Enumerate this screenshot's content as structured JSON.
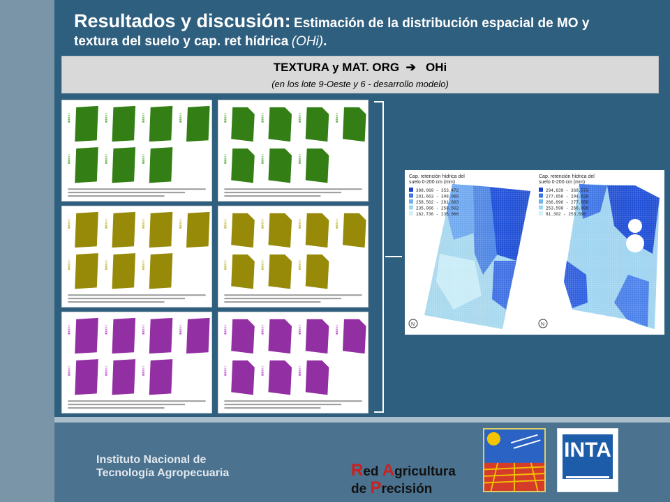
{
  "title": {
    "main": "Resultados y discusión:",
    "sub_line1": "Estimación de la distribución espacial de MO y",
    "sub_line2": "textura del suelo y cap. ret hídrica",
    "sub_italic": "(OHi)",
    "sub_end": "."
  },
  "banner": {
    "heading_left": "TEXTURA y MAT. ORG",
    "arrow": "➔",
    "heading_right": "OHi",
    "subtitle": "(en los lote 9-Oeste  y 6 - desarrollo modelo)"
  },
  "panels": {
    "green_color": "#3f9b1c",
    "yellow_color": "#b7a90a",
    "purple_color": "#b23ac6"
  },
  "result_map": {
    "left_legend_title": "Cap. retención hídrica del suelo 0-200 cm (mm)",
    "left_legend": [
      "308.069 - 353.472",
      "281.663 - 308.069",
      "258.502 - 281.663",
      "235.066 - 258.502",
      "162.736 - 235.066"
    ],
    "right_legend_title": "Cap. retención hídrica del suelo 0-200 cm (mm)",
    "right_legend": [
      "294.639 - 368.573",
      "277.656 - 294.639",
      "266.896 - 277.656",
      "253.598 - 266.896",
      "81.302 - 253.598"
    ],
    "legend_colors": [
      "#1c3fd0",
      "#3f74e3",
      "#6fb0ee",
      "#9fd6f2",
      "#d4f0f8"
    ]
  },
  "footer": {
    "institution_line1": "Instituto Nacional de",
    "institution_line2": "Tecnología Agropecuaria",
    "rap_r": "R",
    "rap_ed": "ed ",
    "rap_a": "A",
    "rap_gricultura": "gricultura",
    "rap_de": "de ",
    "rap_p": "P",
    "rap_recision": "recisión",
    "inta_label": "INTA"
  }
}
